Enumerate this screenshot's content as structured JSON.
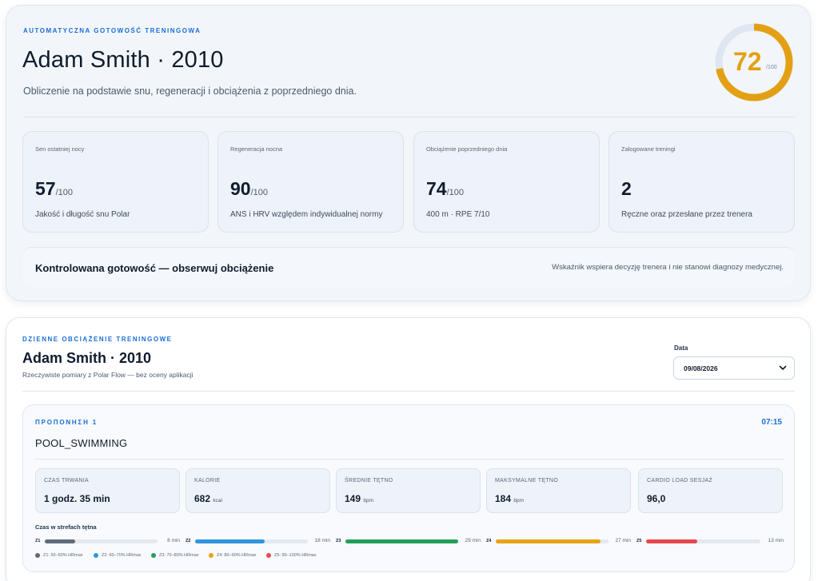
{
  "readiness": {
    "eyebrow": "AUTOMATYCZNA GOTOWOŚĆ TRENINGOWA",
    "title": "Adam Smith · 2010",
    "subtitle": "Obliczenie na podstawie snu, regeneracji i obciążenia z poprzedniego dnia.",
    "score": {
      "value": "72",
      "max": "/100",
      "fraction": 0.72,
      "color": "#e3a014",
      "track_color": "#dde6f1"
    },
    "metrics": [
      {
        "label": "Sen ostatniej nocy",
        "value": "57",
        "unit": "/100",
        "desc": "Jakość i długość snu Polar"
      },
      {
        "label": "Regeneracja nocna",
        "value": "90",
        "unit": "/100",
        "desc": "ANS i HRV względem indywidualnej normy"
      },
      {
        "label": "Obciążenie poprzedniego dnia",
        "value": "74",
        "unit": "/100",
        "desc": "400 m · RPE 7/10"
      },
      {
        "label": "Zalogowane treningi",
        "value": "2",
        "unit": "",
        "desc": "Ręczne oraz przesłane przez trenera"
      }
    ],
    "status": {
      "title": "Kontrolowana gotowość — obserwuj obciążenie",
      "note": "Wskaźnik wspiera decyzję trenera i nie stanowi diagnozy medycznej."
    }
  },
  "daily_load": {
    "eyebrow": "DZIENNE OBCIĄŻENIE TRENINGOWE",
    "title": "Adam Smith · 2010",
    "subtitle": "Rzeczywiste pomiary z Polar Flow — bez oceny aplikacji",
    "date": {
      "label": "Data",
      "value": "09/08/2026",
      "icon": "chevron-down-icon"
    },
    "session": {
      "eyebrow": "ΠΡΟΠΟΝΗΣΗ 1",
      "time": "07:15",
      "name": "POOL_SWIMMING",
      "stats": [
        {
          "label": "CZAS TRWANIA",
          "value": "1 godz. 35 min",
          "unit": ""
        },
        {
          "label": "KALORIE",
          "value": "682",
          "unit": "kcal"
        },
        {
          "label": "ŚREDNIE TĘTNO",
          "value": "149",
          "unit": "bpm"
        },
        {
          "label": "MAKSYMALNE TĘTNO",
          "value": "184",
          "unit": "bpm"
        },
        {
          "label": "CARDIO LOAD SESJAŻ",
          "value": "96,0",
          "unit": ""
        }
      ],
      "zones_title": "Czas w strefach tętna",
      "zones": [
        {
          "id": "Z1",
          "minutes": "8 min",
          "fraction": 0.27,
          "color": "#5f6b7a"
        },
        {
          "id": "Z2",
          "minutes": "18 min",
          "fraction": 0.62,
          "color": "#2f95dc"
        },
        {
          "id": "Z3",
          "minutes": "29 min",
          "fraction": 1.0,
          "color": "#22a05a"
        },
        {
          "id": "Z4",
          "minutes": "27 min",
          "fraction": 0.93,
          "color": "#e8a317"
        },
        {
          "id": "Z5",
          "minutes": "13 min",
          "fraction": 0.45,
          "color": "#e5484d"
        }
      ],
      "legend": [
        {
          "text": "Z1: 50–60% HRmax",
          "color": "#5f6b7a"
        },
        {
          "text": "Z2: 60–70% HRmax",
          "color": "#2f95dc"
        },
        {
          "text": "Z3: 70–80% HRmax",
          "color": "#22a05a"
        },
        {
          "text": "Z4: 80–90% HRmax",
          "color": "#e8a317"
        },
        {
          "text": "Z5: 90–100% HRmax",
          "color": "#e5484d"
        }
      ]
    }
  }
}
